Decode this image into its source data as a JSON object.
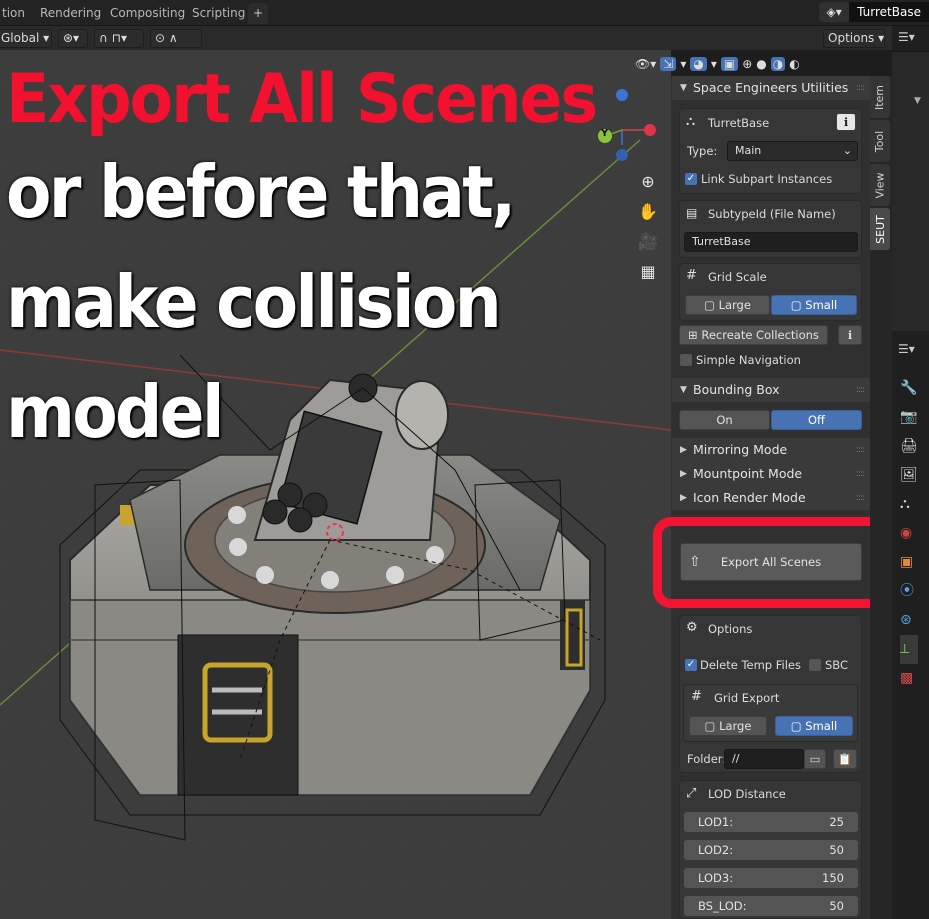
{
  "workspace_tabs": [
    "tion",
    "Rendering",
    "Compositing",
    "Scripting",
    "+"
  ],
  "scene_name": "TurretBase",
  "header": {
    "transform_orientation": "Global",
    "options_label": "Options"
  },
  "overlay": {
    "line1": "Export All Scenes",
    "line2": "or before that,",
    "line3": "make collision",
    "line4": "model"
  },
  "axis_gizmo": {
    "y_label": "Y"
  },
  "panel_tabs": [
    "Item",
    "Tool",
    "View",
    "SEUT"
  ],
  "panel": {
    "title": "Space Engineers Utilities",
    "object_name": "TurretBase",
    "type_label": "Type:",
    "type_value": "Main",
    "link_subpart": "Link Subpart Instances",
    "subtype_label": "SubtypeId (File Name)",
    "subtype_value": "TurretBase",
    "grid_scale_label": "Grid Scale",
    "large": "Large",
    "small": "Small",
    "recreate_collections": "Recreate Collections",
    "simple_navigation": "Simple Navigation",
    "bounding_box": "Bounding Box",
    "on": "On",
    "off": "Off",
    "mirroring_mode": "Mirroring Mode",
    "mountpoint_mode": "Mountpoint Mode",
    "icon_render_mode": "Icon Render Mode",
    "export_all_scenes": "Export All Scenes",
    "options_label": "Options",
    "delete_temp_files": "Delete Temp Files",
    "sbc": "SBC",
    "grid_export": "Grid Export",
    "folder_label": "Folder:",
    "folder_value": "//",
    "lod_distance": "LOD Distance",
    "lods": [
      {
        "label": "LOD1:",
        "value": "25"
      },
      {
        "label": "LOD2:",
        "value": "50"
      },
      {
        "label": "LOD3:",
        "value": "150"
      },
      {
        "label": "BS_LOD:",
        "value": "50"
      }
    ]
  }
}
